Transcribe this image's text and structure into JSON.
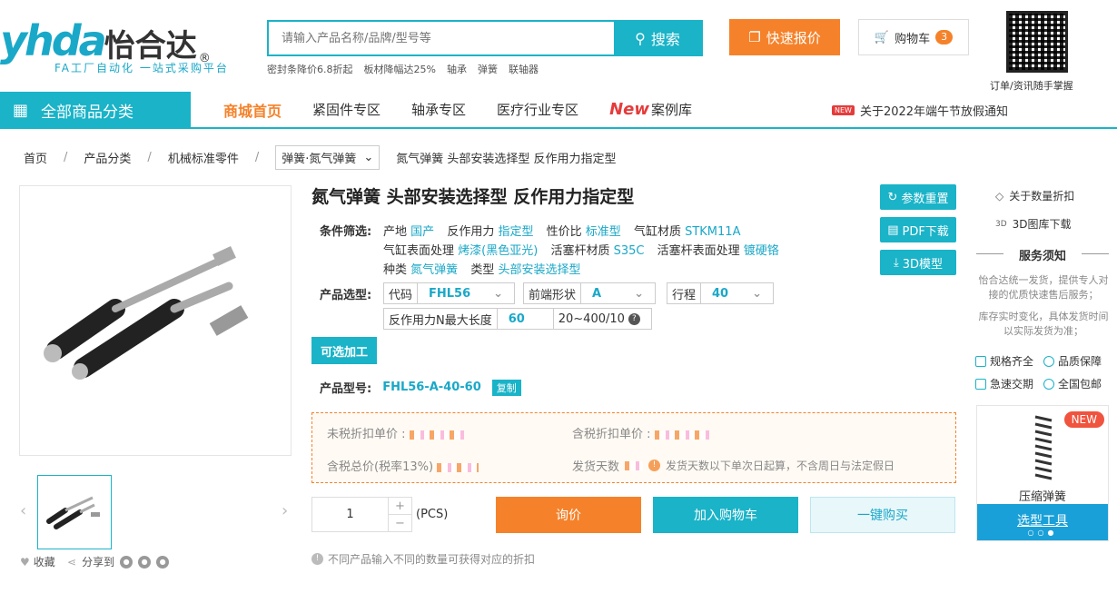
{
  "header": {
    "logo_cn": "怡合达",
    "logo_sub": "FA工厂自动化 一站式采购平台",
    "search_placeholder": "请输入产品名称/品牌/型号等",
    "search_button": "搜索",
    "hot_words": [
      "密封条降价6.8折起",
      "板材降幅达25%",
      "轴承",
      "弹簧",
      "联轴器"
    ],
    "quote_button": "快速报价",
    "cart_label": "购物车",
    "cart_count": "3",
    "qr_caption": "订单/资讯随手掌握"
  },
  "nav": {
    "all_categories": "全部商品分类",
    "items": [
      "商城首页",
      "紧固件专区",
      "轴承专区",
      "医疗行业专区",
      "案例库"
    ],
    "case_tag": "New",
    "notice_badge": "NEW",
    "notice_text": "关于2022年端午节放假通知"
  },
  "breadcrumb": {
    "items": [
      "首页",
      "产品分类",
      "机械标准零件"
    ],
    "select": "弹簧·氮气弹簧",
    "current": "氮气弹簧 头部安装选择型 反作用力指定型"
  },
  "gallery": {
    "fav": "收藏",
    "share": "分享到"
  },
  "product": {
    "title": "氮气弹簧 头部安装选择型 反作用力指定型",
    "reset_button": "参数重置",
    "pdf_button": "PDF下载",
    "model3d_button": "3D模型",
    "conditions_label": "条件筛选:",
    "conditions": [
      {
        "k": "产地",
        "v": "国产"
      },
      {
        "k": "反作用力",
        "v": "指定型"
      },
      {
        "k": "性价比",
        "v": "标准型"
      },
      {
        "k": "气缸材质",
        "v": "STKM11A"
      },
      {
        "k": "气缸表面处理",
        "v": "烤漆(黑色亚光)"
      },
      {
        "k": "活塞杆材质",
        "v": "S35C"
      },
      {
        "k": "活塞杆表面处理",
        "v": "镀硬铬"
      },
      {
        "k": "种类",
        "v": "氮气弹簧"
      },
      {
        "k": "类型",
        "v": "头部安装选择型"
      }
    ],
    "selection_label": "产品选型:",
    "sel_code_k": "代码",
    "sel_code_v": "FHL56",
    "sel_front_k": "前端形状",
    "sel_front_v": "A",
    "sel_stroke_k": "行程",
    "sel_stroke_v": "40",
    "sel_force_k": "反作用力N最大长度",
    "sel_force_v": "60",
    "sel_force_range": "20~400/10",
    "optional_button": "可选加工",
    "model_label": "产品型号:",
    "model_code": "FHL56-A-40-60",
    "copy_button": "复制",
    "price_untaxed": "未税折扣单价 :",
    "price_taxed": "含税折扣单价 :",
    "total_taxed": "含税总价(税率13%)",
    "ship_days": "发货天数",
    "ship_note": "发货天数以下单次日起算，不含周日与法定假日",
    "qty": "1",
    "unit": "(PCS)",
    "inquiry_button": "询价",
    "add_cart_button": "加入购物车",
    "buy_now_button": "一键购买",
    "hint": "不同产品输入不同的数量可获得对应的折扣"
  },
  "sidebar": {
    "qty_discount": "关于数量折扣",
    "cad_download": "3D图库下载",
    "service_title": "服务须知",
    "service_text1": "怡合达统一发货，提供专人对接的优质快速售后服务；",
    "service_text2": "库存实时变化，具体发货时间以实际发货为准；",
    "badges": [
      "规格齐全",
      "品质保障",
      "急速交期",
      "全国包邮"
    ],
    "card_new": "NEW",
    "card_label": "压缩弹簧",
    "card_tool": "选型工具"
  },
  "colors": {
    "accent": "#1ab3c8",
    "orange": "#f5822a",
    "blue_tool": "#1aa0d8"
  }
}
